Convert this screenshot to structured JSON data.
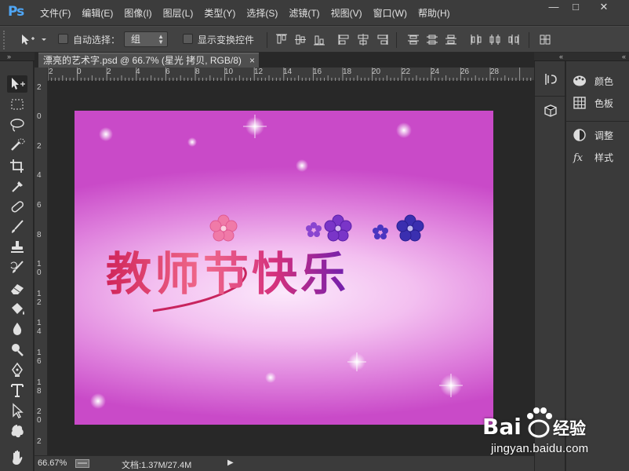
{
  "app": {
    "logo": "Ps"
  },
  "menu": [
    "文件(F)",
    "编辑(E)",
    "图像(I)",
    "图层(L)",
    "类型(Y)",
    "选择(S)",
    "滤镜(T)",
    "视图(V)",
    "窗口(W)",
    "帮助(H)"
  ],
  "window_controls": {
    "minimize": "—",
    "maximize": "□",
    "close": "✕"
  },
  "options_bar": {
    "auto_select_label": "自动选择：",
    "auto_select_value": "组",
    "show_transform_label": "显示变换控件"
  },
  "document": {
    "tab_title": "漂亮的艺术字.psd @ 66.7% (星光 拷贝, RGB/8)",
    "tab_close": "×",
    "artwork_text": "教师节快乐"
  },
  "ruler": {
    "top": [
      "2",
      "0",
      "2",
      "4",
      "6",
      "8",
      "10",
      "12",
      "14",
      "16",
      "18",
      "20",
      "22",
      "24",
      "26",
      "28"
    ],
    "left": [
      "2",
      "0",
      "2",
      "4",
      "6",
      "8",
      "10",
      "12",
      "14",
      "16",
      "18",
      "20",
      "2"
    ]
  },
  "status": {
    "zoom": "66.67%",
    "doc_info": "文档:1.37M/27.4M",
    "arrow": "▶"
  },
  "panels": [
    {
      "icon": "color-palette-icon",
      "label": "颜色"
    },
    {
      "icon": "swatches-grid-icon",
      "label": "色板"
    },
    {
      "icon": "adjustments-icon",
      "label": "调整"
    },
    {
      "icon": "styles-fx-icon",
      "label": "样式"
    }
  ],
  "watermark": {
    "logo": "Bai",
    "brand": "经验",
    "url": "jingyan.baidu.com"
  },
  "colors": {
    "ps_blue": "#4fa6f5",
    "chrome_dark": "#282828",
    "chrome_mid": "#3c3c3c",
    "canvas_magenta": "#c94ac8"
  }
}
